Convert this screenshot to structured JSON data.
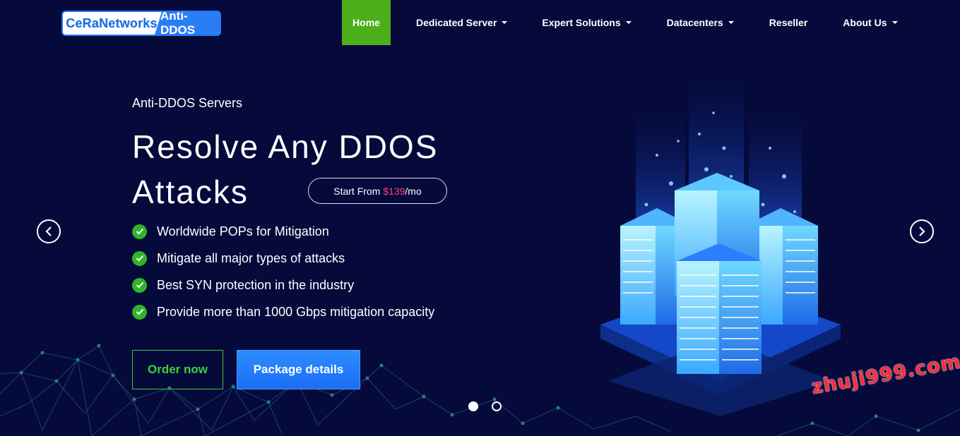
{
  "logo": {
    "part1": "CeRaNetworks",
    "part2": "Anti-DDOS"
  },
  "nav": [
    {
      "label": "Home",
      "active": true,
      "dropdown": false
    },
    {
      "label": "Dedicated Server",
      "active": false,
      "dropdown": true
    },
    {
      "label": "Expert Solutions",
      "active": false,
      "dropdown": true
    },
    {
      "label": "Datacenters",
      "active": false,
      "dropdown": true
    },
    {
      "label": "Reseller",
      "active": false,
      "dropdown": false
    },
    {
      "label": "About Us",
      "active": false,
      "dropdown": true
    }
  ],
  "hero": {
    "eyebrow": "Anti-DDOS Servers",
    "headline": "Resolve Any DDOS Attacks",
    "price": {
      "prefix": "Start From ",
      "amount": "$139",
      "suffix": "/mo"
    },
    "features": [
      "Worldwide POPs for Mitigation",
      "Mitigate all major types of attacks",
      "Best SYN protection in the industry",
      "Provide more than 1000 Gbps mitigation capacity"
    ],
    "order_label": "Order now",
    "package_label": "Package details"
  },
  "carousel": {
    "slides": 2,
    "active": 1
  },
  "watermark": "zhuji999.com",
  "colors": {
    "background": "#050a3b",
    "accent_green": "#4caf1a",
    "accent_blue": "#1a6ef5",
    "price_pink": "#ff3e7f"
  }
}
